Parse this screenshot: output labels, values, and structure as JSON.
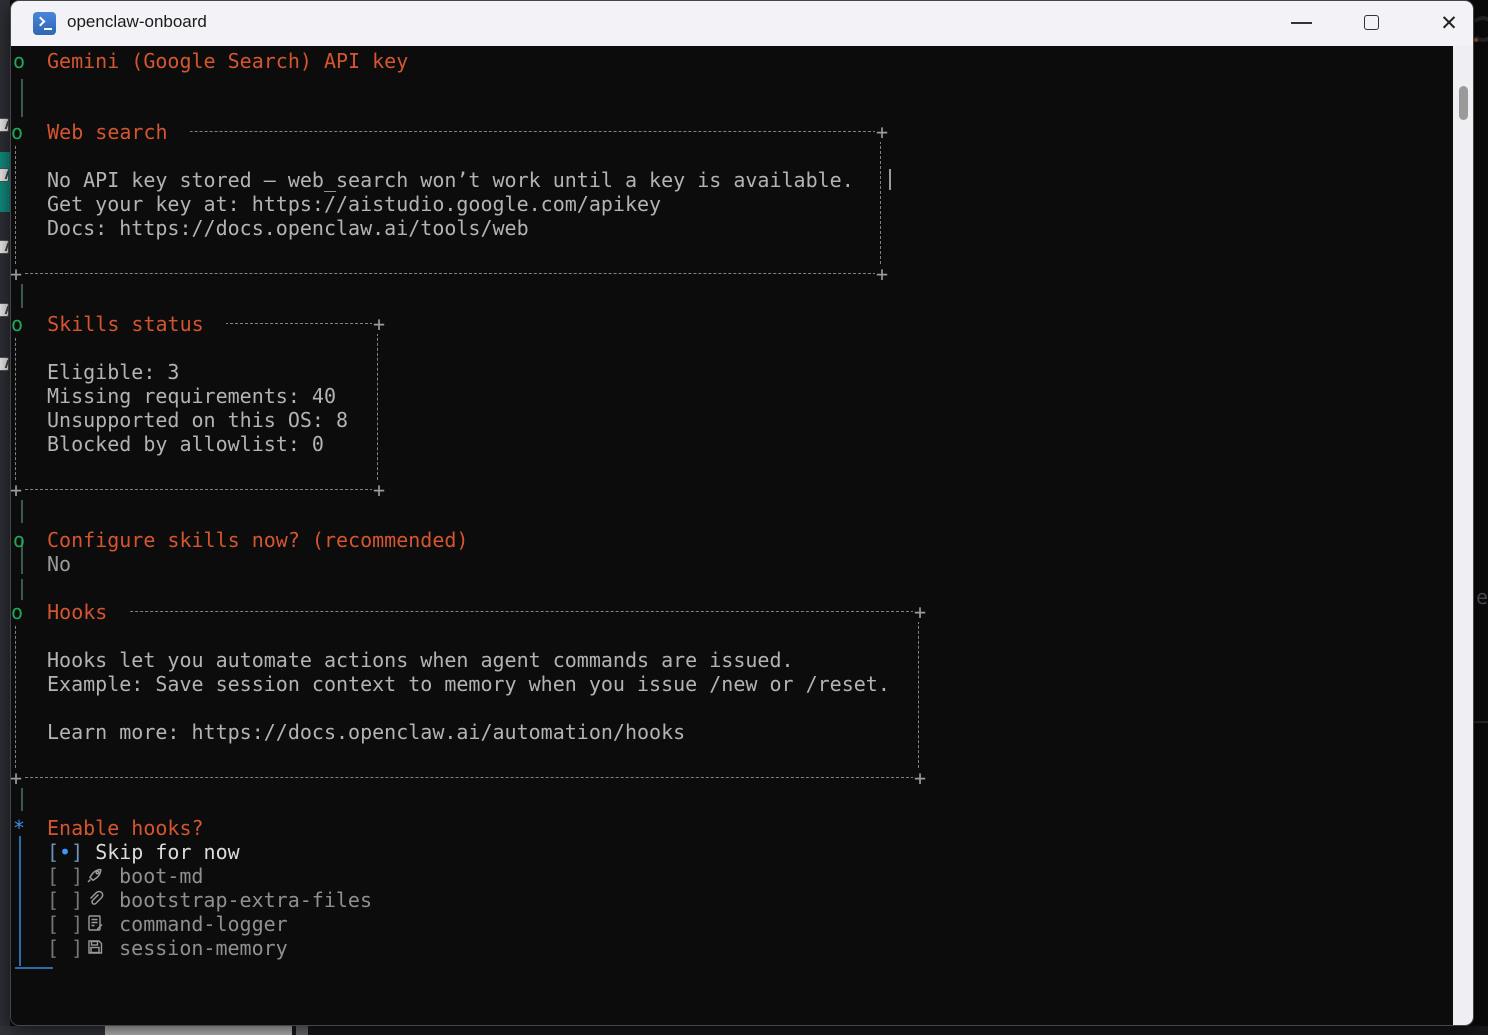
{
  "window": {
    "title": "openclaw-onboard",
    "controls": {
      "close_glyph": "✕"
    }
  },
  "chrome": {
    "corner": "+",
    "bracket_left": "[",
    "bracket_right": "]",
    "selected_dot": "•",
    "cursor_artifact": "|",
    "background_partial_text": "e."
  },
  "colors": {
    "terminal_bg": "#0c0c0c",
    "heading_orange": "#d4552f",
    "marker_green": "#23a55a",
    "accent_blue": "#3b8eea",
    "body_gray": "#b3b3b3",
    "teal_strip": "#128a7e"
  },
  "sections": {
    "gemini": {
      "marker": "o",
      "title": "Gemini (Google Search) API key"
    },
    "web_search": {
      "marker": "o",
      "title": "Web search",
      "lines": [
        "No API key stored — web_search won’t work until a key is available.",
        "Get your key at: https://aistudio.google.com/apikey",
        "Docs: https://docs.openclaw.ai/tools/web"
      ]
    },
    "skills_status": {
      "marker": "o",
      "title": "Skills status",
      "stats": [
        {
          "line": "Eligible: 3"
        },
        {
          "line": "Missing requirements: 40"
        },
        {
          "line": "Unsupported on this OS: 8"
        },
        {
          "line": "Blocked by allowlist: 0"
        }
      ]
    },
    "configure_skills": {
      "marker": "o",
      "question": "Configure skills now? (recommended)",
      "answer": "No"
    },
    "hooks": {
      "marker": "o",
      "title": "Hooks",
      "lines": [
        "Hooks let you automate actions when agent commands are issued.",
        "Example: Save session context to memory when you issue /new or /reset."
      ],
      "learn_more": "Learn more: https://docs.openclaw.ai/automation/hooks"
    },
    "enable_hooks": {
      "marker": "*",
      "question": "Enable hooks?",
      "options": [
        {
          "selected": true,
          "icon": null,
          "label": "Skip for now"
        },
        {
          "selected": false,
          "icon": "rocket-icon",
          "label": "boot-md"
        },
        {
          "selected": false,
          "icon": "paperclip-icon",
          "label": "bootstrap-extra-files"
        },
        {
          "selected": false,
          "icon": "memo-icon",
          "label": "command-logger"
        },
        {
          "selected": false,
          "icon": "floppy-icon",
          "label": "session-memory"
        }
      ]
    }
  }
}
